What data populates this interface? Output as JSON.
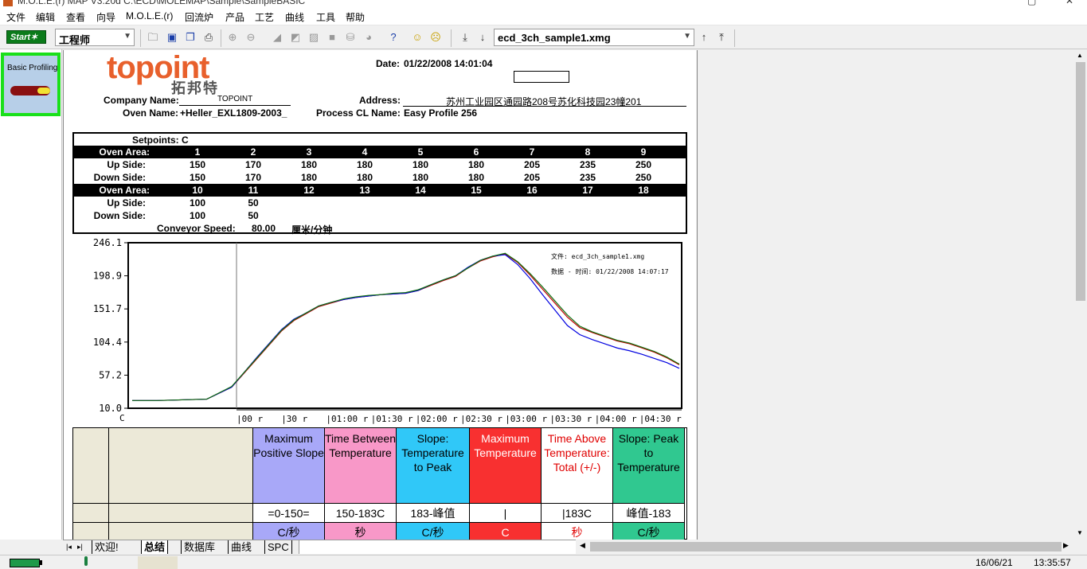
{
  "window": {
    "title": "M.O.L.E.(r) MAP V3.20d   C:\\ECD\\MOLEMAP\\Sample\\SampleBASIC"
  },
  "menu": [
    "文件",
    "编辑",
    "查看",
    "向导",
    "M.O.L.E.(r)",
    "回流炉",
    "产品",
    "工艺",
    "曲线",
    "工具",
    "帮助"
  ],
  "toolbar": {
    "start_label": "Start",
    "role_value": "工程师",
    "file_value": "ecd_3ch_sample1.xmg"
  },
  "left_panel": {
    "basic_profiling_label": "Basic Profiling"
  },
  "report": {
    "logo_text": "topoint",
    "logo_cn": "拓邦特",
    "date_label": "Date:",
    "date_value": "01/22/2008 14:01:04",
    "company_label": "Company Name:",
    "company_value": "TOPOINT",
    "address_label": "Address:",
    "address_value": "苏州工业园区通园路208号苏化科技园23幢201",
    "oven_label": "Oven Name:",
    "oven_value": "+Heller_EXL1809-2003_",
    "process_label": "Process CL Name:",
    "process_value": "Easy Profile 256",
    "setpoints_label": "Setpoints: C",
    "oven_area_label": "Oven Area:",
    "up_side_label": "Up  Side:",
    "down_side_label": "Down  Side:",
    "areas1": [
      "1",
      "2",
      "3",
      "4",
      "5",
      "6",
      "7",
      "8",
      "9"
    ],
    "up1": [
      "150",
      "170",
      "180",
      "180",
      "180",
      "180",
      "205",
      "235",
      "250"
    ],
    "down1": [
      "150",
      "170",
      "180",
      "180",
      "180",
      "180",
      "205",
      "235",
      "250"
    ],
    "areas2": [
      "10",
      "11",
      "12",
      "13",
      "14",
      "15",
      "16",
      "17",
      "18"
    ],
    "up2": [
      "100",
      "50",
      "",
      "",
      "",
      "",
      "",
      "",
      ""
    ],
    "down2": [
      "100",
      "50",
      "",
      "",
      "",
      "",
      "",
      "",
      ""
    ],
    "conveyor_label": "Conveyor Speed:",
    "conveyor_value": "80.00",
    "conveyor_unit": "厘米/分钟"
  },
  "chart_data": {
    "type": "line",
    "file_annotation": "文件: ecd_3ch_sample1.xmg",
    "time_annotation": "数据 - 时间: 01/22/2008 14:07:17",
    "y_ticks": [
      "246.1",
      "198.9",
      "151.7",
      "104.4",
      "57.2",
      "10.0"
    ],
    "ylim": [
      10.0,
      246.1
    ],
    "y_unit": "C",
    "x_ticks": [
      "|00 r",
      "|30 r",
      "|01:00 r",
      "|01:30 r",
      "|02:00 r",
      "|02:30 r",
      "|03:00 r",
      "|03:30 r",
      "|04:00 r",
      "|04:30 r"
    ],
    "x": [
      0,
      20,
      40,
      60,
      80,
      100,
      110,
      120,
      130,
      140,
      150,
      160,
      170,
      180,
      190,
      200,
      210,
      220,
      230,
      240,
      250,
      260,
      270,
      280,
      290,
      300,
      310,
      320,
      330,
      340,
      350,
      360,
      370,
      380,
      390,
      400,
      410,
      420,
      430,
      440
    ],
    "series": [
      {
        "color": "#c00000",
        "values": [
          21,
          21,
          22,
          23,
          40,
          80,
          100,
          120,
          135,
          145,
          155,
          160,
          165,
          168,
          170,
          172,
          173,
          174,
          178,
          185,
          192,
          198,
          210,
          220,
          226,
          230,
          218,
          200,
          180,
          160,
          140,
          125,
          118,
          112,
          106,
          102,
          96,
          90,
          82,
          72
        ]
      },
      {
        "color": "#0000e0",
        "values": [
          21,
          21,
          22,
          23,
          40,
          82,
          102,
          122,
          137,
          146,
          156,
          161,
          165,
          168,
          170,
          172,
          173,
          174,
          178,
          186,
          193,
          199,
          211,
          221,
          227,
          229,
          215,
          195,
          172,
          150,
          128,
          115,
          108,
          102,
          96,
          92,
          87,
          81,
          75,
          67
        ]
      },
      {
        "color": "#107010",
        "values": [
          21,
          21,
          22,
          23,
          41,
          81,
          101,
          121,
          136,
          146,
          156,
          161,
          166,
          169,
          171,
          172,
          174,
          175,
          179,
          186,
          193,
          199,
          210,
          221,
          227,
          231,
          219,
          202,
          183,
          163,
          143,
          127,
          119,
          113,
          107,
          103,
          97,
          91,
          83,
          73
        ]
      }
    ]
  },
  "grid": {
    "headers": [
      {
        "text": "Maximum Positive Slope",
        "bg": "#a8a8f8",
        "fg": "#000"
      },
      {
        "text": "Time Between Temperature",
        "bg": "#f898c8",
        "fg": "#000"
      },
      {
        "text": "Slope: Temperature to Peak",
        "bg": "#30c8f8",
        "fg": "#000"
      },
      {
        "text": "Maximum Temperature",
        "bg": "#f83030",
        "fg": "#fff"
      },
      {
        "text": "Time Above Temperature: Total (+/-)",
        "bg": "#ffffff",
        "fg": "#e00000"
      },
      {
        "text": "Slope: Peak to Temperature",
        "bg": "#30c890",
        "fg": "#000"
      }
    ],
    "range_row": [
      "=0-150=",
      "150-183C",
      "183-峰值",
      "|",
      "|183C",
      "峰值-183"
    ],
    "unit_row": [
      "C/秒",
      "秒",
      "C/秒",
      "C",
      "秒",
      "C/秒"
    ]
  },
  "tabs": [
    "欢迎!",
    "总结",
    "数据库",
    "曲线",
    "SPC"
  ],
  "status": {
    "date": "16/06/21",
    "time": "13:35:57"
  }
}
